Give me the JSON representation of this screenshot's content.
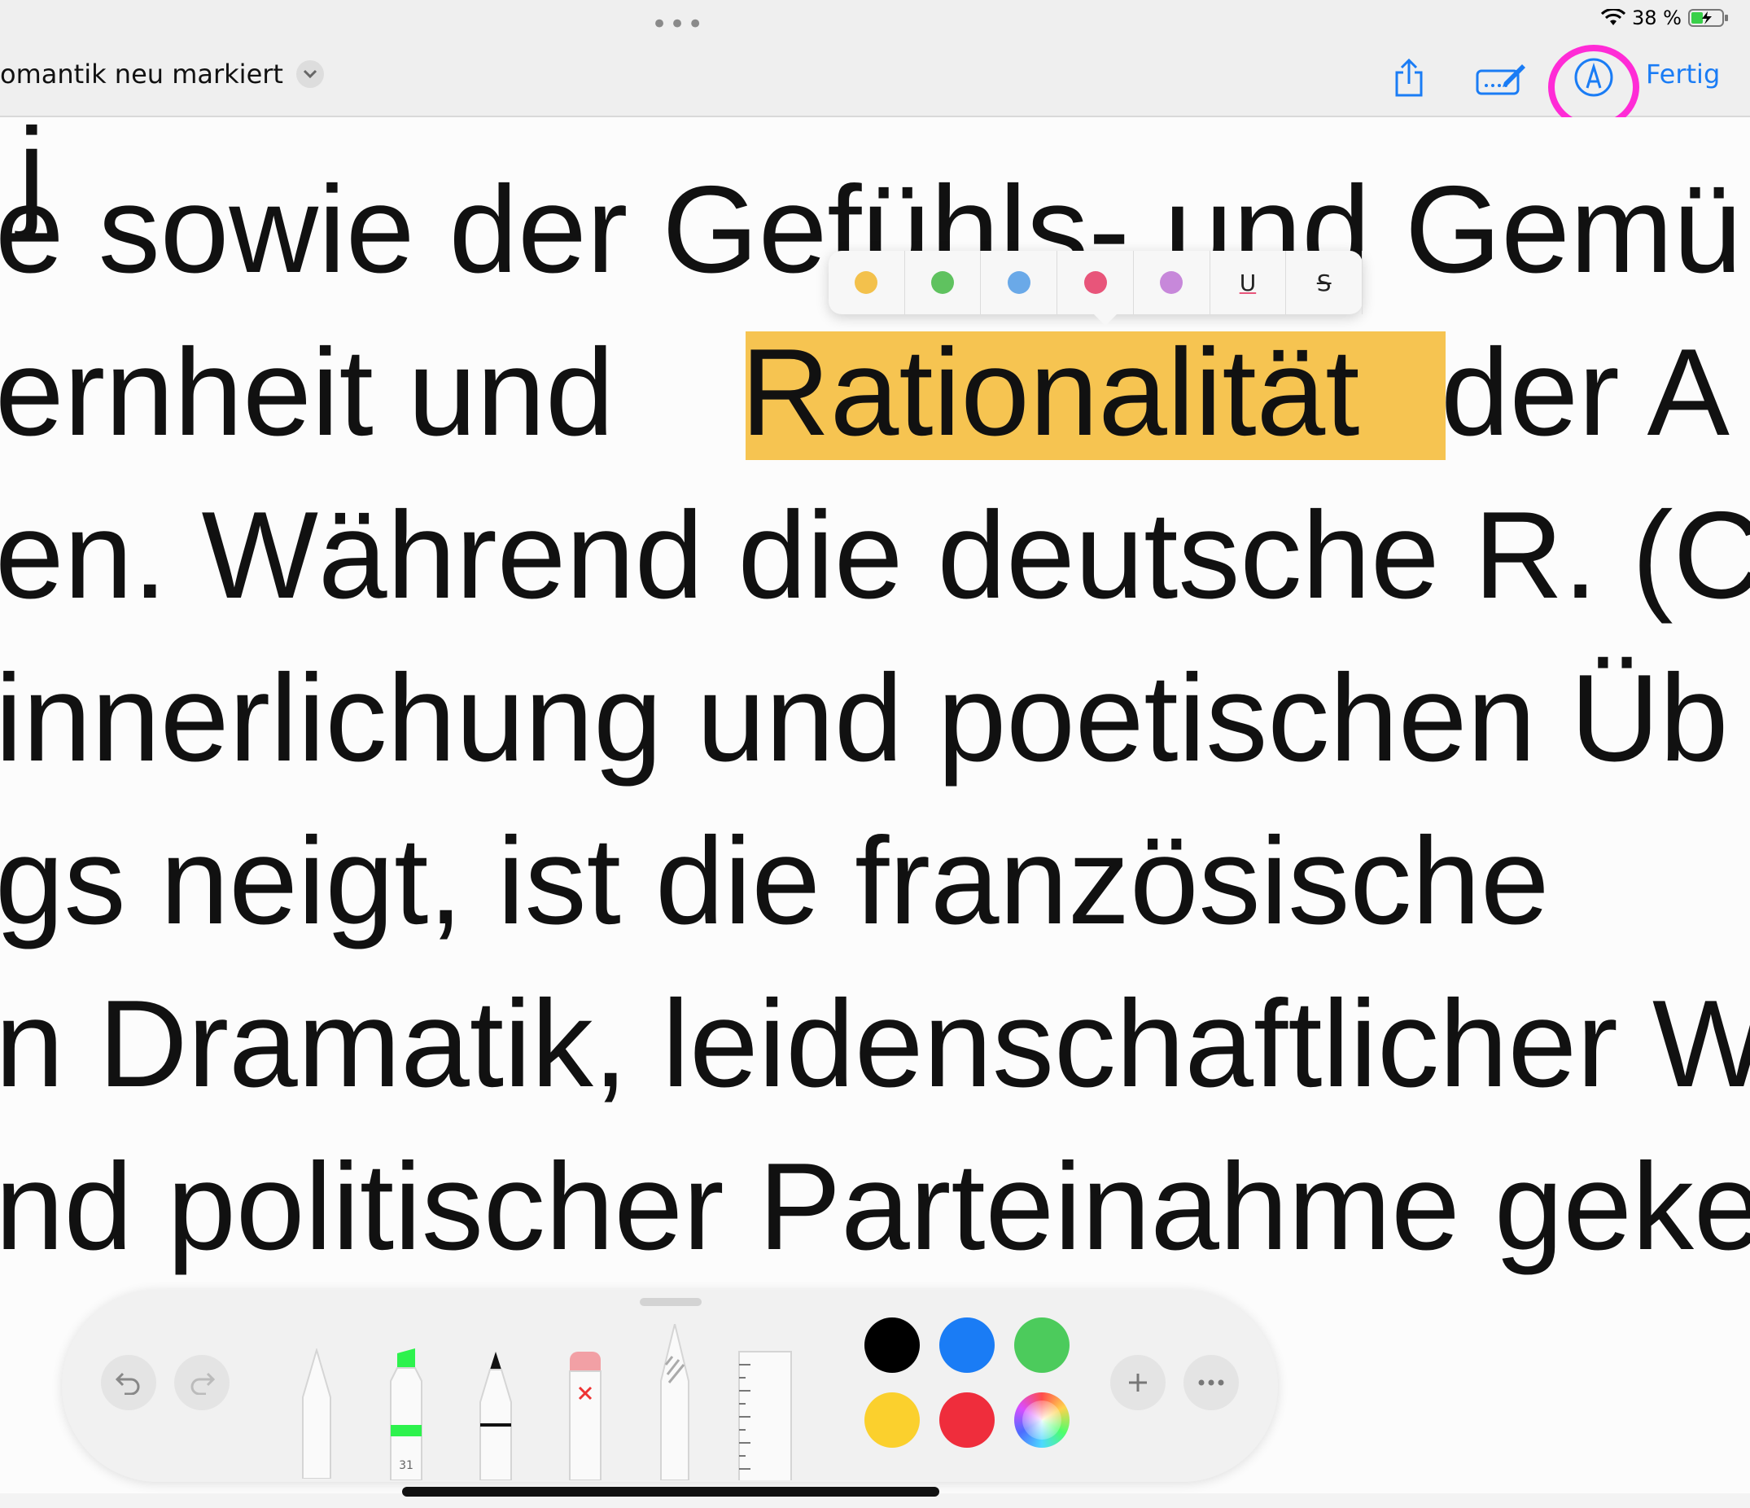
{
  "status": {
    "battery_percent": "38 %"
  },
  "header": {
    "title": "omantik neu markiert",
    "done_label": "Fertig"
  },
  "document": {
    "lines": [
      "e sowie der Gefühls- und Gemü",
      "ernheit und",
      "Rationalität",
      "der A",
      "en. Während die deutsche R. (C",
      "innerlichung und poetischen Üb",
      "gs neigt, ist die französische",
      "n Dramatik, leidenschaftlicher W",
      "nd politischer Parteinahme geker"
    ],
    "highlight_color": "#f6c451"
  },
  "popup": {
    "colors": [
      "#f3c14c",
      "#5fc25f",
      "#6aa9e8",
      "#e8557a",
      "#c788da"
    ],
    "underline_label": "U",
    "strike_label": "S"
  },
  "palette": {
    "marker_size": "31",
    "colors": [
      "#000000",
      "#1a7cf5",
      "#4ccb5c",
      "#fbd02d",
      "#ef2d3c"
    ],
    "marker_color": "#2df24d"
  },
  "accent": "#1a7cf5",
  "annotation_circle_color": "#ff2bd6"
}
